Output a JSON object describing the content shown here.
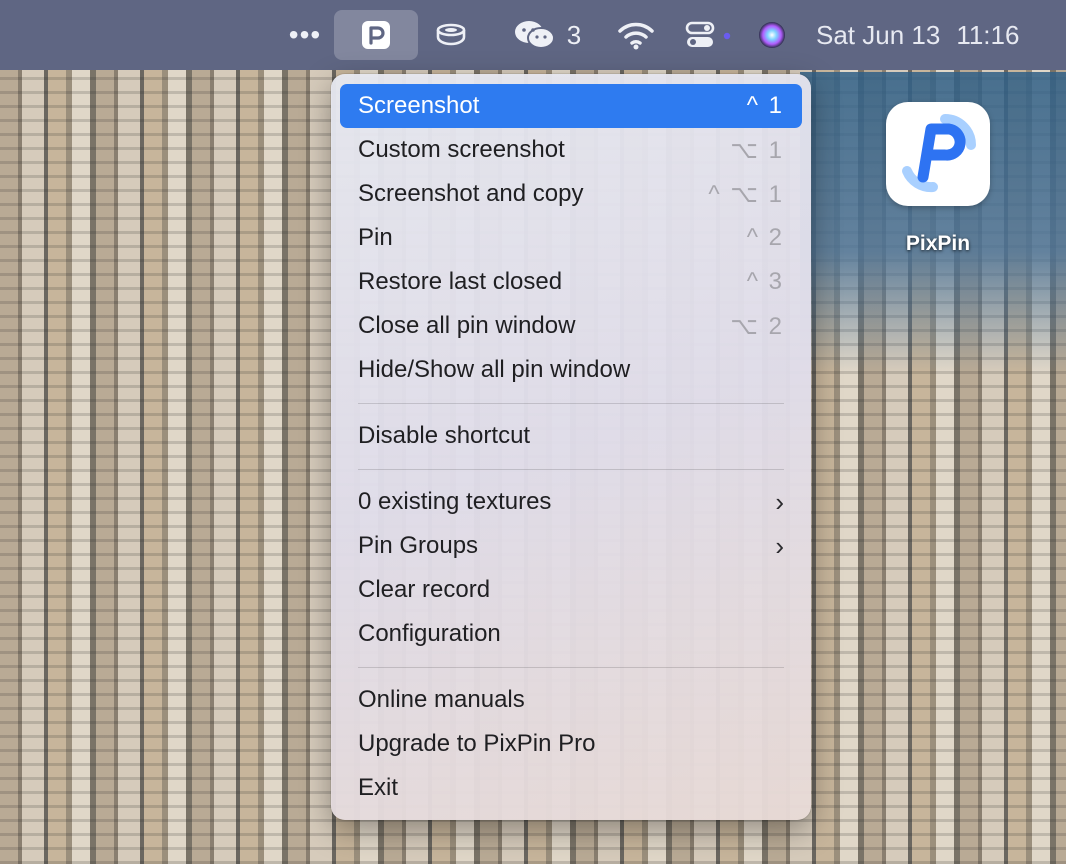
{
  "menubar": {
    "more_glyph": "•••",
    "pixpin_icon": "pixpin-menubar-icon",
    "teacup_icon": "teacup-icon",
    "wechat": {
      "icon": "wechat-icon",
      "count": "3"
    },
    "wifi_icon": "wifi-icon",
    "control_icon": "control-center-icon",
    "siri_icon": "siri-icon",
    "date": "Sat Jun 13",
    "time": "11:16"
  },
  "desktop": {
    "app_label": "PixPin",
    "app_icon": "pixpin-app-icon"
  },
  "menu": {
    "items": [
      {
        "label": "Screenshot",
        "shortcut": "^ 1",
        "selected": true
      },
      {
        "label": "Custom screenshot",
        "shortcut": "⌥ 1"
      },
      {
        "label": "Screenshot and copy",
        "shortcut": "^ ⌥ 1"
      },
      {
        "label": "Pin",
        "shortcut": "^ 2"
      },
      {
        "label": "Restore last closed",
        "shortcut": "^ 3"
      },
      {
        "label": "Close all pin window",
        "shortcut": "⌥ 2"
      },
      {
        "label": "Hide/Show all pin window",
        "shortcut": ""
      },
      {
        "label": "Disable shortcut",
        "shortcut": ""
      },
      {
        "label": "0 existing textures",
        "submenu": true
      },
      {
        "label": "Pin Groups",
        "submenu": true
      },
      {
        "label": "Clear record",
        "shortcut": ""
      },
      {
        "label": "Configuration",
        "shortcut": ""
      },
      {
        "label": "Online manuals",
        "shortcut": ""
      },
      {
        "label": "Upgrade to PixPin Pro",
        "shortcut": ""
      },
      {
        "label": "Exit",
        "shortcut": ""
      }
    ],
    "submenu_glyph": "›",
    "accent_color": "#2e7bf0"
  }
}
